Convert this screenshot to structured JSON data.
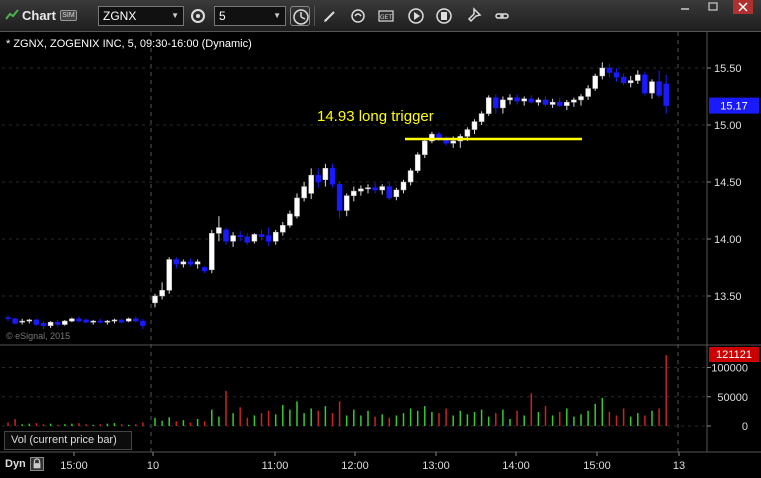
{
  "toolbar": {
    "title": "Chart",
    "sim_badge": "SIM",
    "symbol_value": "ZGNX",
    "interval_value": "5",
    "icons": [
      "chart-icon",
      "cursor-icon",
      "pencil-icon",
      "link-icon",
      "get-icon",
      "play-icon",
      "bookmark-icon",
      "pin-icon"
    ]
  },
  "chart": {
    "header": "* ZGNX, ZOGENIX INC, 5, 09:30-16:00 (Dynamic)",
    "watermark": "© eSignal, 2015",
    "annotation": "14.93 long trigger",
    "current_price_label": "15.17",
    "volume_current_label": "121121",
    "volume_panel_label": "Vol (current price bar)",
    "dyn_label": "Dyn",
    "colors": {
      "background": "#000000",
      "up_candle": "#ffffff",
      "down_candle": "#1a1aff",
      "annotation": "#ffff00",
      "volume_up": "#33cc33",
      "volume_down": "#cc2222",
      "price_tag": "#1a1aff",
      "volume_tag": "#cc0000"
    }
  },
  "chart_data": {
    "type": "candlestick",
    "price_axis": {
      "ticks": [
        "15.50",
        "15.00",
        "14.50",
        "14.00",
        "13.50"
      ],
      "tick_values": [
        15.5,
        15.0,
        14.5,
        14.0,
        13.5
      ],
      "ylim": [
        13.1,
        15.75
      ]
    },
    "volume_axis": {
      "ticks": [
        "100000",
        "50000",
        "0"
      ],
      "tick_values": [
        100000,
        50000,
        0
      ],
      "ylim": [
        0,
        120000
      ]
    },
    "time_axis": {
      "ticks": [
        "15:00",
        "10",
        "11:00",
        "12:00",
        "13:00",
        "14:00",
        "15:00",
        "13"
      ]
    },
    "trigger_level": 14.93,
    "candles": [
      [
        13.31,
        13.33,
        13.28,
        13.3
      ],
      [
        13.3,
        13.31,
        13.25,
        13.26
      ],
      [
        13.27,
        13.3,
        13.25,
        13.28
      ],
      [
        13.28,
        13.3,
        13.26,
        13.29
      ],
      [
        13.29,
        13.3,
        13.24,
        13.25
      ],
      [
        13.26,
        13.28,
        13.21,
        13.24
      ],
      [
        13.24,
        13.28,
        13.22,
        13.27
      ],
      [
        13.27,
        13.29,
        13.23,
        13.25
      ],
      [
        13.25,
        13.29,
        13.24,
        13.28
      ],
      [
        13.28,
        13.31,
        13.27,
        13.3
      ],
      [
        13.3,
        13.32,
        13.27,
        13.28
      ],
      [
        13.29,
        13.3,
        13.26,
        13.27
      ],
      [
        13.27,
        13.29,
        13.25,
        13.28
      ],
      [
        13.28,
        13.3,
        13.26,
        13.27
      ],
      [
        13.27,
        13.29,
        13.25,
        13.28
      ],
      [
        13.28,
        13.3,
        13.26,
        13.29
      ],
      [
        13.29,
        13.3,
        13.26,
        13.27
      ],
      [
        13.28,
        13.31,
        13.27,
        13.3
      ],
      [
        13.3,
        13.32,
        13.27,
        13.28
      ],
      [
        13.28,
        13.3,
        13.21,
        13.24
      ],
      [
        13.44,
        13.52,
        13.4,
        13.5
      ],
      [
        13.5,
        13.62,
        13.47,
        13.55
      ],
      [
        13.55,
        13.84,
        13.52,
        13.82
      ],
      [
        13.82,
        13.84,
        13.74,
        13.78
      ],
      [
        13.78,
        13.82,
        13.75,
        13.8
      ],
      [
        13.8,
        13.83,
        13.76,
        13.78
      ],
      [
        13.78,
        13.82,
        13.74,
        13.8
      ],
      [
        13.75,
        13.76,
        13.7,
        13.72
      ],
      [
        13.73,
        14.08,
        13.7,
        14.05
      ],
      [
        14.05,
        14.2,
        13.98,
        14.1
      ],
      [
        14.08,
        14.1,
        13.95,
        13.98
      ],
      [
        13.98,
        14.06,
        13.93,
        14.03
      ],
      [
        14.03,
        14.07,
        13.98,
        14.02
      ],
      [
        14.02,
        14.05,
        13.95,
        13.97
      ],
      [
        13.98,
        14.05,
        13.96,
        14.04
      ],
      [
        14.04,
        14.08,
        13.99,
        14.02
      ],
      [
        14.03,
        14.1,
        13.94,
        13.98
      ],
      [
        13.98,
        14.08,
        13.95,
        14.06
      ],
      [
        14.06,
        14.15,
        14.03,
        14.12
      ],
      [
        14.12,
        14.25,
        14.1,
        14.22
      ],
      [
        14.2,
        14.4,
        14.18,
        14.36
      ],
      [
        14.36,
        14.5,
        14.33,
        14.46
      ],
      [
        14.4,
        14.62,
        14.35,
        14.56
      ],
      [
        14.56,
        14.62,
        14.45,
        14.5
      ],
      [
        14.52,
        14.66,
        14.46,
        14.62
      ],
      [
        14.62,
        14.66,
        14.45,
        14.48
      ],
      [
        14.48,
        14.5,
        14.18,
        14.25
      ],
      [
        14.25,
        14.4,
        14.2,
        14.38
      ],
      [
        14.38,
        14.46,
        14.33,
        14.42
      ],
      [
        14.42,
        14.47,
        14.38,
        14.44
      ],
      [
        14.44,
        14.48,
        14.4,
        14.45
      ],
      [
        14.45,
        14.49,
        14.4,
        14.43
      ],
      [
        14.43,
        14.48,
        14.39,
        14.46
      ],
      [
        14.46,
        14.5,
        14.34,
        14.36
      ],
      [
        14.37,
        14.45,
        14.34,
        14.43
      ],
      [
        14.43,
        14.52,
        14.4,
        14.5
      ],
      [
        14.5,
        14.62,
        14.47,
        14.6
      ],
      [
        14.6,
        14.76,
        14.58,
        14.74
      ],
      [
        14.74,
        14.88,
        14.71,
        14.86
      ],
      [
        14.86,
        14.94,
        14.84,
        14.92
      ],
      [
        14.92,
        14.94,
        14.86,
        14.88
      ],
      [
        14.88,
        14.9,
        14.82,
        14.84
      ],
      [
        14.84,
        14.9,
        14.8,
        14.86
      ],
      [
        14.86,
        14.92,
        14.8,
        14.9
      ],
      [
        14.9,
        14.98,
        14.86,
        14.96
      ],
      [
        14.96,
        15.05,
        14.92,
        15.03
      ],
      [
        15.03,
        15.12,
        15.0,
        15.1
      ],
      [
        15.1,
        15.26,
        15.08,
        15.24
      ],
      [
        15.24,
        15.27,
        15.1,
        15.15
      ],
      [
        15.15,
        15.25,
        15.1,
        15.22
      ],
      [
        15.22,
        15.27,
        15.18,
        15.24
      ],
      [
        15.24,
        15.27,
        15.18,
        15.21
      ],
      [
        15.21,
        15.25,
        15.17,
        15.23
      ],
      [
        15.23,
        15.26,
        15.19,
        15.2
      ],
      [
        15.2,
        15.24,
        15.17,
        15.22
      ],
      [
        15.22,
        15.25,
        15.16,
        15.18
      ],
      [
        15.18,
        15.23,
        15.15,
        15.2
      ],
      [
        15.2,
        15.24,
        15.16,
        15.17
      ],
      [
        15.17,
        15.22,
        15.13,
        15.2
      ],
      [
        15.2,
        15.24,
        15.16,
        15.22
      ],
      [
        15.22,
        15.27,
        15.17,
        15.25
      ],
      [
        15.25,
        15.35,
        15.22,
        15.32
      ],
      [
        15.32,
        15.45,
        15.3,
        15.43
      ],
      [
        15.43,
        15.55,
        15.4,
        15.5
      ],
      [
        15.5,
        15.54,
        15.42,
        15.46
      ],
      [
        15.46,
        15.5,
        15.38,
        15.42
      ],
      [
        15.42,
        15.45,
        15.35,
        15.37
      ],
      [
        15.37,
        15.43,
        15.33,
        15.39
      ],
      [
        15.39,
        15.48,
        15.36,
        15.44
      ],
      [
        15.44,
        15.47,
        15.26,
        15.28
      ],
      [
        15.28,
        15.4,
        15.23,
        15.38
      ],
      [
        15.38,
        15.48,
        15.24,
        15.26
      ],
      [
        15.36,
        15.44,
        15.1,
        15.17
      ]
    ],
    "volumes": [
      6000,
      12000,
      3000,
      4000,
      5000,
      3000,
      4000,
      2000,
      3000,
      4000,
      5000,
      3000,
      2000,
      3000,
      4000,
      5000,
      3000,
      2000,
      3000,
      6000,
      14000,
      9000,
      15000,
      8000,
      10000,
      6000,
      12000,
      8000,
      28000,
      16000,
      60000,
      22000,
      32000,
      14000,
      18000,
      22000,
      26000,
      20000,
      36000,
      28000,
      42000,
      22000,
      30000,
      26000,
      34000,
      22000,
      42000,
      18000,
      28000,
      18000,
      26000,
      16000,
      20000,
      14000,
      18000,
      22000,
      30000,
      26000,
      34000,
      24000,
      22000,
      30000,
      18000,
      26000,
      20000,
      24000,
      28000,
      16000,
      22000,
      28000,
      12000,
      26000,
      18000,
      56000,
      24000,
      34000,
      18000,
      24000,
      30000,
      16000,
      20000,
      26000,
      38000,
      48000,
      24000,
      18000,
      30000,
      16000,
      22000,
      18000,
      26000,
      30000,
      121121
    ],
    "volume_colors": "mixed"
  }
}
